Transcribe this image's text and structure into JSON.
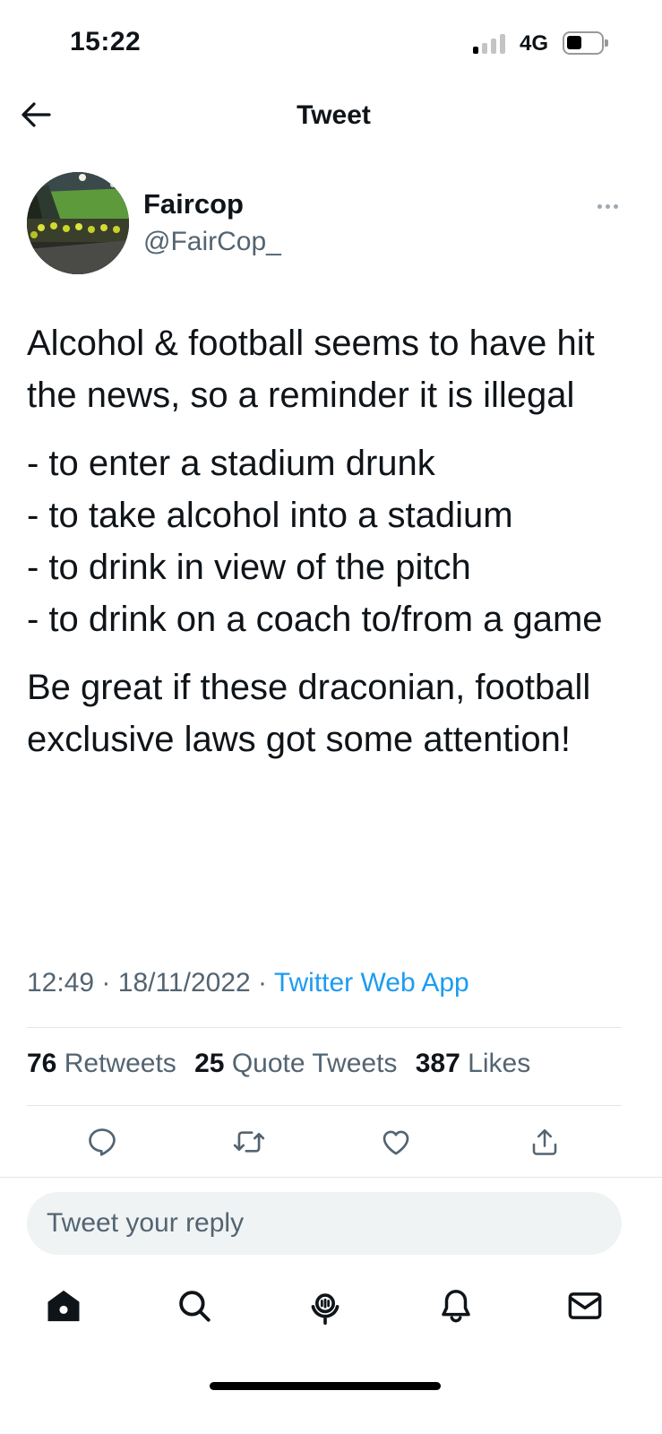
{
  "status_bar": {
    "time": "15:22",
    "network": "4G",
    "signal_bars_active": 1,
    "signal_bars_total": 4
  },
  "nav": {
    "title": "Tweet",
    "back_icon": "arrow-left-icon"
  },
  "tweet": {
    "author_name": "Faircop",
    "author_handle": "@FairCop_",
    "more_icon": "more-dots-icon",
    "paragraphs": [
      "Alcohol & football seems to have hit the news, so a reminder it is illegal",
      "- to enter a stadium drunk\n- to take alcohol into a stadium\n- to drink in view of the pitch\n- to drink on a coach to/from a game",
      "Be great if these draconian, football exclusive laws got some attention!"
    ],
    "time": "12:49",
    "date": "18/11/2022",
    "source": "Twitter Web App",
    "separator": "·"
  },
  "stats": {
    "retweets_count": "76",
    "retweets_label": "Retweets",
    "quotes_count": "25",
    "quotes_label": "Quote Tweets",
    "likes_count": "387",
    "likes_label": "Likes"
  },
  "actions": {
    "icons": [
      "reply-icon",
      "retweet-icon",
      "like-icon",
      "share-icon"
    ]
  },
  "reply": {
    "placeholder": "Tweet your reply"
  },
  "tabbar": {
    "icons": [
      "home-icon",
      "search-icon",
      "spaces-icon",
      "notifications-icon",
      "messages-icon"
    ]
  },
  "colors": {
    "text": "#0f1419",
    "secondary": "#536471",
    "link": "#1d9bf0",
    "divider": "#e1e6ea",
    "reply_bg": "#eff3f4"
  }
}
